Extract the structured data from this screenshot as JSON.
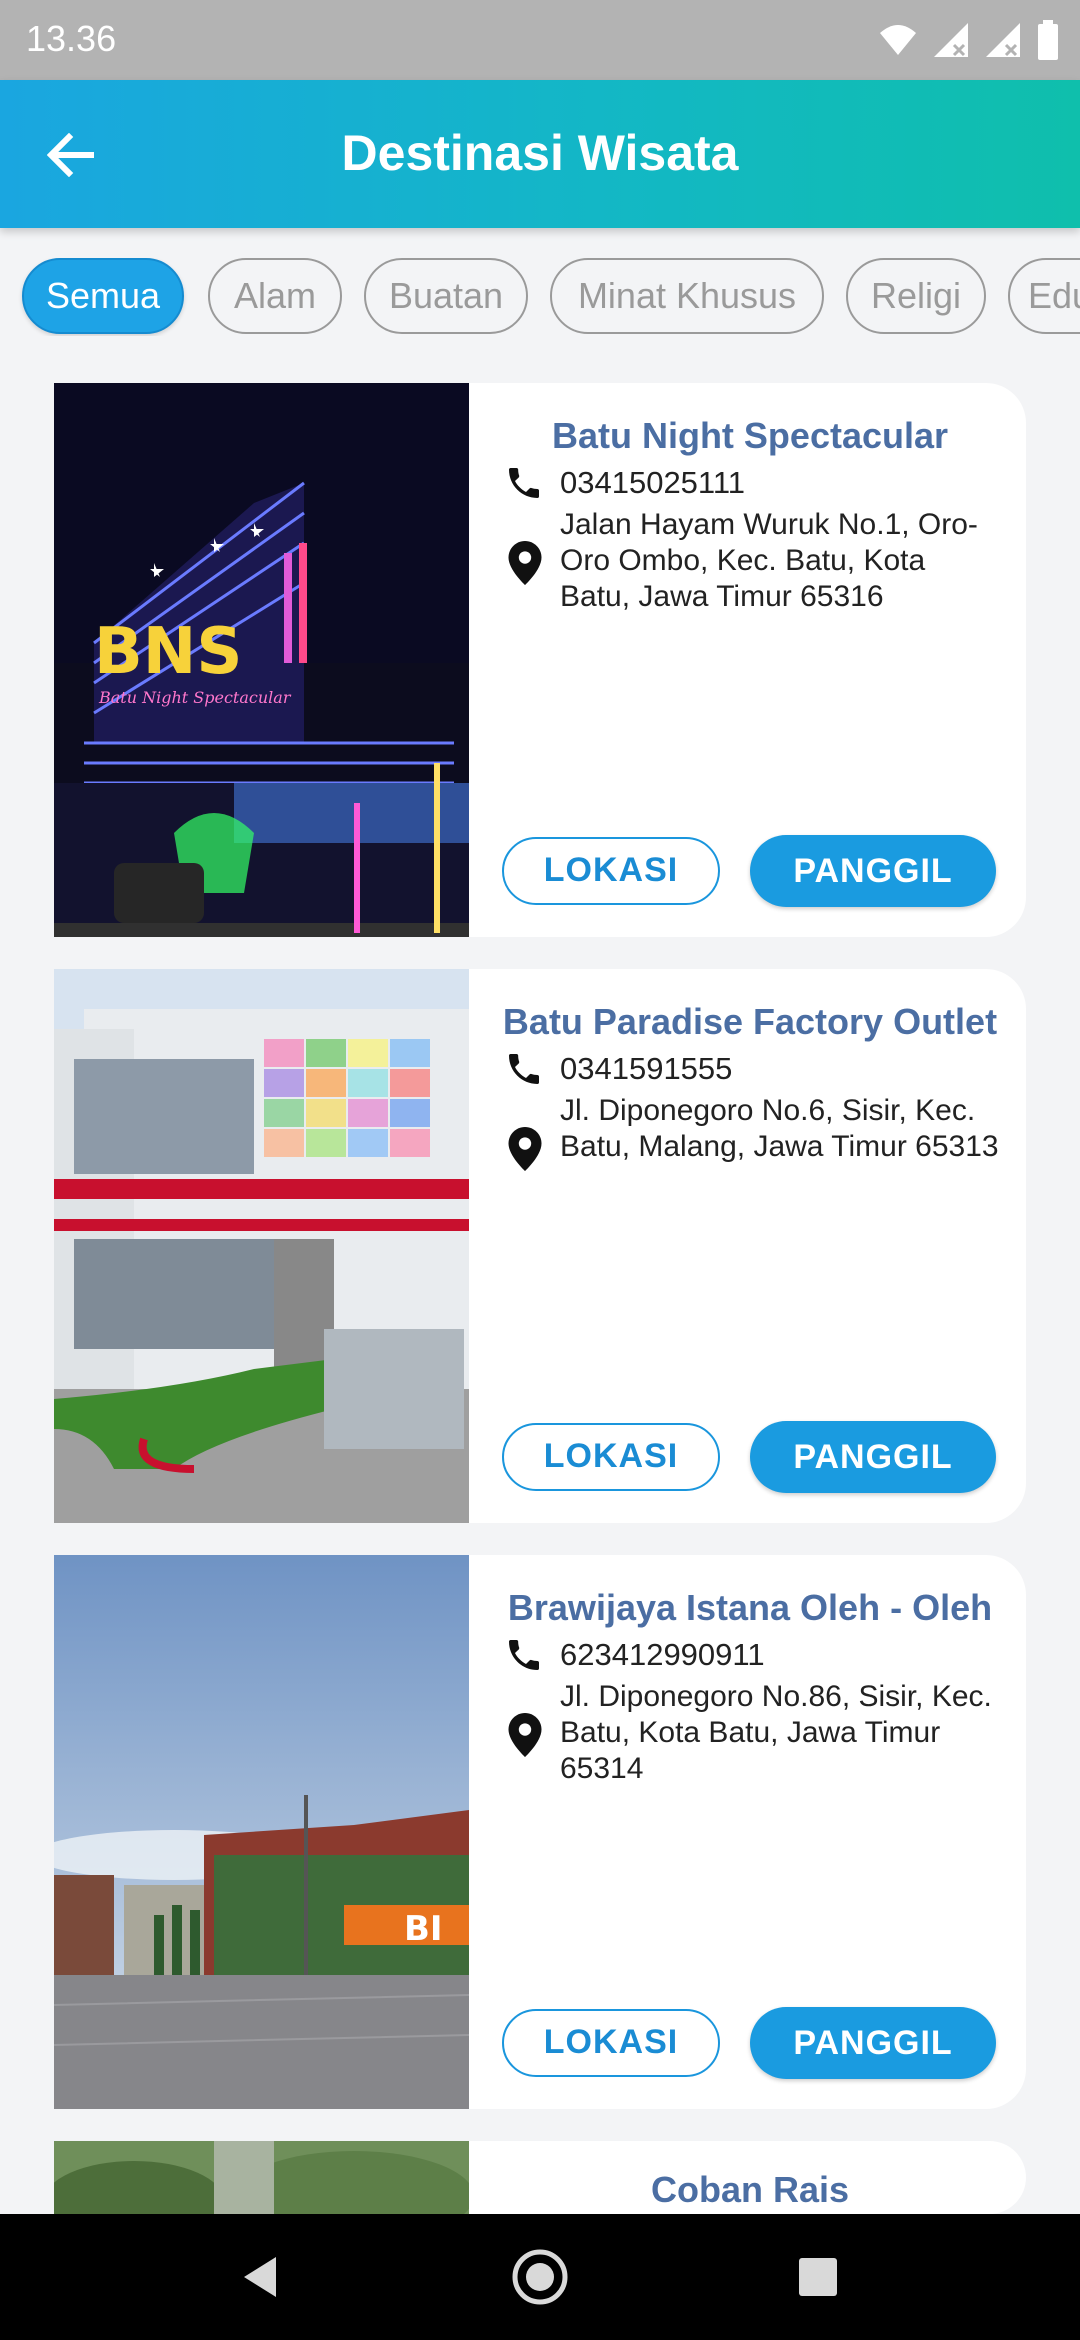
{
  "status_bar": {
    "time": "13.36",
    "icons": [
      "wifi-icon",
      "signal-icon",
      "signal-icon",
      "battery-icon"
    ]
  },
  "app_bar": {
    "title": "Destinasi Wisata",
    "back_icon": "arrow-back-icon"
  },
  "categories": {
    "selected": "Semua",
    "items": [
      "Semua",
      "Alam",
      "Buatan",
      "Minat Khusus",
      "Religi",
      "Edu"
    ]
  },
  "destinations": [
    {
      "name": "Batu Night Spectacular",
      "phone": "03415025111",
      "address": "Jalan Hayam Wuruk No.1, Oro-Oro Ombo, Kec. Batu, Kota Batu, Jawa Timur 65316",
      "location_label": "LOKASI",
      "call_label": "PANGGIL"
    },
    {
      "name": "Batu Paradise Factory Outlet",
      "phone": "0341591555",
      "address": "Jl. Diponegoro No.6, Sisir, Kec. Batu, Malang, Jawa Timur 65313",
      "location_label": "LOKASI",
      "call_label": "PANGGIL"
    },
    {
      "name": "Brawijaya Istana Oleh - Oleh",
      "phone": "623412990911",
      "address": "Jl. Diponegoro No.86, Sisir, Kec. Batu, Kota Batu, Jawa Timur 65314",
      "location_label": "LOKASI",
      "call_label": "PANGGIL"
    },
    {
      "name": "Coban Rais"
    }
  ],
  "nav_bar": {
    "buttons": [
      "back-triangle-icon",
      "home-circle-icon",
      "recents-square-icon"
    ]
  },
  "colors": {
    "accent": "#1a9be0",
    "title": "#4b6ea3",
    "app_bar_start": "#1aa6e0",
    "app_bar_end": "#0fbfac"
  }
}
